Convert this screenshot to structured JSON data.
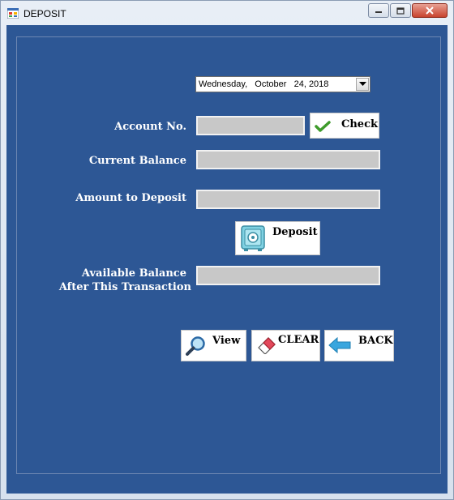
{
  "window": {
    "title": "DEPOSIT"
  },
  "date_picker": {
    "value": "Wednesday,   October   24, 2018"
  },
  "form": {
    "account_no_label": "Account No.",
    "current_balance_label": "Current Balance",
    "amount_label": "Amount to Deposit",
    "available_label_line1": "Available Balance",
    "available_label_line2": "After This Transaction",
    "account_no_value": "",
    "current_balance_value": "",
    "amount_value": "",
    "available_value": ""
  },
  "buttons": {
    "check": "Check",
    "deposit": "Deposit",
    "view": "View",
    "clear": "CLEAR",
    "back": "BACK"
  },
  "icons": {
    "check": "checkmark-icon",
    "deposit": "safe-icon",
    "view": "magnifier-icon",
    "clear": "eraser-icon",
    "back": "back-arrow-icon"
  }
}
